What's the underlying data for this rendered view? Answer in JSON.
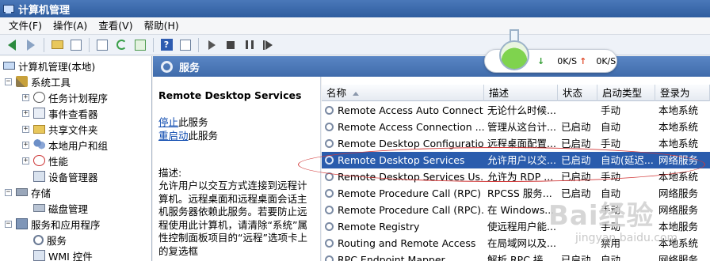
{
  "window": {
    "title": "计算机管理"
  },
  "menu": [
    "文件(F)",
    "操作(A)",
    "查看(V)",
    "帮助(H)"
  ],
  "toolbar": {
    "icons": [
      "back-icon",
      "forward-icon",
      "up-folder-icon",
      "show-hide-tree-icon",
      "properties-icon",
      "refresh-icon",
      "export-icon",
      "help-icon",
      "action-pane-icon",
      "start-service-icon",
      "stop-service-icon",
      "pause-service-icon",
      "restart-service-icon"
    ]
  },
  "tree": {
    "root": "计算机管理(本地)",
    "system_tools": "系统工具",
    "task_scheduler": "任务计划程序",
    "event_viewer": "事件查看器",
    "shared_folders": "共享文件夹",
    "local_users": "本地用户和组",
    "performance": "性能",
    "device_manager": "设备管理器",
    "storage": "存储",
    "disk_management": "磁盘管理",
    "services_apps": "服务和应用程序",
    "services": "服务",
    "wmi": "WMI 控件"
  },
  "panel": {
    "header": "服务"
  },
  "description": {
    "service_name": "Remote Desktop Services",
    "stop_link": "停止",
    "stop_suffix": "此服务",
    "restart_link": "重启动",
    "restart_suffix": "此服务",
    "label": "描述:",
    "text": "允许用户以交互方式连接到远程计算机。远程桌面和远程桌面会话主机服务器依赖此服务。若要防止远程使用此计算机，请清除“系统”属性控制面板项目的“远程”选项卡上的复选框"
  },
  "table": {
    "columns": [
      "名称",
      "描述",
      "状态",
      "启动类型",
      "登录为"
    ],
    "rows": [
      {
        "name": "Remote Access Auto Connect...",
        "desc": "无论什么时候...",
        "status": "",
        "startup": "手动",
        "logon": "本地系统"
      },
      {
        "name": "Remote Access Connection ...",
        "desc": "管理从这台计...",
        "status": "已启动",
        "startup": "自动",
        "logon": "本地系统"
      },
      {
        "name": "Remote Desktop Configuration",
        "desc": "远程桌面配置...",
        "status": "已启动",
        "startup": "手动",
        "logon": "本地系统"
      },
      {
        "name": "Remote Desktop Services",
        "desc": "允许用户以交...",
        "status": "已启动",
        "startup": "自动(延迟...",
        "logon": "网络服务",
        "selected": true
      },
      {
        "name": "Remote Desktop Services Us...",
        "desc": "允许为 RDP ...",
        "status": "已启动",
        "startup": "手动",
        "logon": "本地系统"
      },
      {
        "name": "Remote Procedure Call (RPC)",
        "desc": "RPCSS 服务...",
        "status": "已启动",
        "startup": "自动",
        "logon": "网络服务"
      },
      {
        "name": "Remote Procedure Call (RPC)...",
        "desc": "在 Windows...",
        "status": "",
        "startup": "手动",
        "logon": "网络服务"
      },
      {
        "name": "Remote Registry",
        "desc": "使远程用户能...",
        "status": "",
        "startup": "手动",
        "logon": "本地服务"
      },
      {
        "name": "Routing and Remote Access",
        "desc": "在局域网以及...",
        "status": "",
        "startup": "禁用",
        "logon": "本地系统"
      },
      {
        "name": "RPC Endpoint Mapper",
        "desc": "解析 RPC 接...",
        "status": "已启动",
        "startup": "自动",
        "logon": "网络服务"
      }
    ]
  },
  "speed_widget": {
    "down": "0K/S",
    "up": "0K/S",
    "down_arrow": "↓",
    "up_arrow": "↑"
  },
  "watermark": {
    "logo": "Bai经验",
    "url": "jingyan.baidu.com"
  },
  "colors": {
    "title_bar": "#2f5d9f",
    "selected_row": "#2a5cad",
    "annotation": "#d23a3a",
    "link": "#0645ad"
  }
}
